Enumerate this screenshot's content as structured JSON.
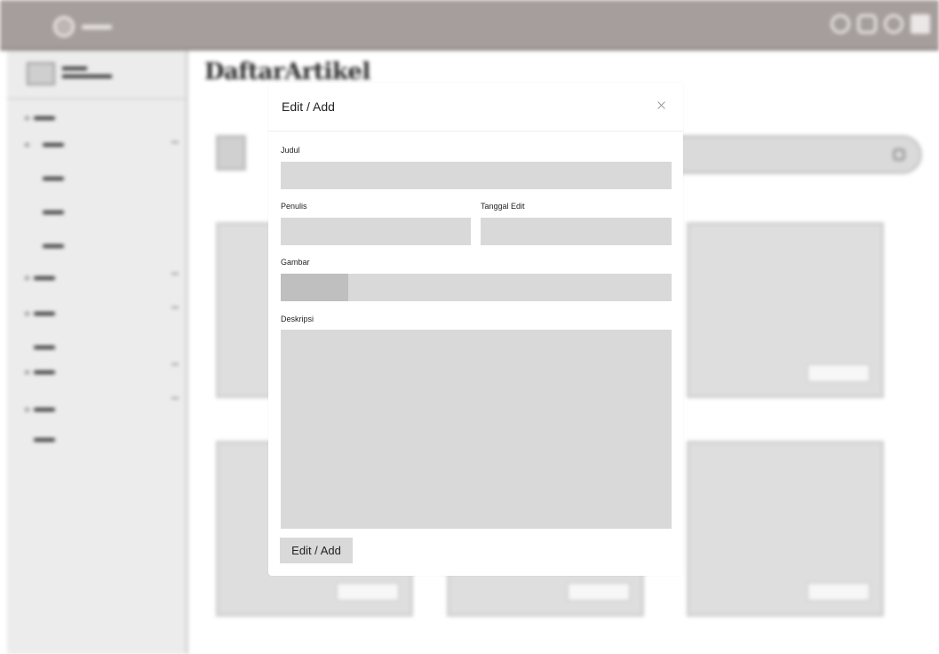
{
  "page": {
    "title": "DaftarArtikel"
  },
  "modal": {
    "title": "Edit / Add",
    "close_icon": "close-icon",
    "fields": {
      "judul_label": "Judul",
      "penulis_label": "Penulis",
      "tanggal_label": "Tanggal Edit",
      "gambar_label": "Gambar",
      "deskripsi_label": "Deskripsi"
    },
    "submit_label": "Edit / Add"
  },
  "icons": {
    "top_bar": [
      "tools-icon",
      "square-icon",
      "user-icon",
      "grid-icon"
    ],
    "search": "search-icon"
  },
  "colors": {
    "topbar": "#a59e9c",
    "field": "#d9d9d9",
    "file_button": "#bfbfbf"
  }
}
